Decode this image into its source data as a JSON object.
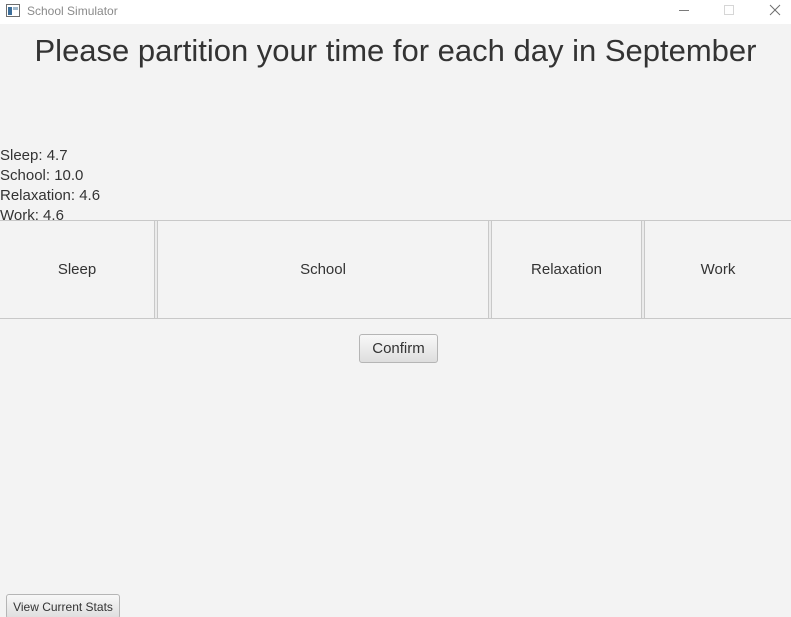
{
  "window": {
    "title": "School Simulator",
    "icons": {
      "app": "app-window-icon",
      "minimize": "minimize-icon",
      "maximize": "maximize-icon",
      "close": "close-icon"
    }
  },
  "heading": "Please partition your time for each day in September",
  "stats": [
    "Sleep: 4.7",
    "School: 10.0",
    "Relaxation: 4.6",
    "Work: 4.6"
  ],
  "panes": [
    {
      "label": "Sleep",
      "hours": 4.7
    },
    {
      "label": "School",
      "hours": 10.0
    },
    {
      "label": "Relaxation",
      "hours": 4.6
    },
    {
      "label": "Work",
      "hours": 4.6
    }
  ],
  "buttons": {
    "confirm": "Confirm",
    "view_stats": "View Current Stats"
  }
}
